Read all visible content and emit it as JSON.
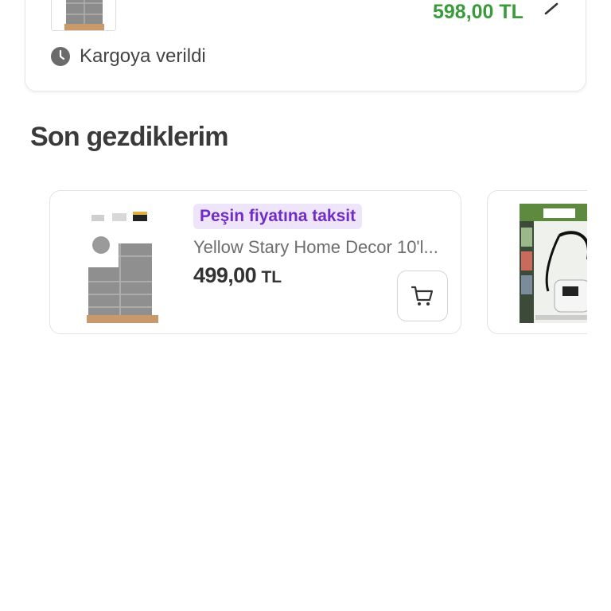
{
  "order": {
    "price": "598,00 TL",
    "status": "Kargoya verildi"
  },
  "recently_viewed": {
    "title": "Son gezdiklerim",
    "items": [
      {
        "badge": "Peşin fiyatına taksit",
        "name": "Yellow Stary Home Decor 10'l...",
        "price": "499,00",
        "currency": "TL"
      }
    ]
  },
  "colors": {
    "price_green": "#3a9b3a",
    "badge_purple": "#6f2cc8",
    "badge_bg": "#efe5fb"
  }
}
